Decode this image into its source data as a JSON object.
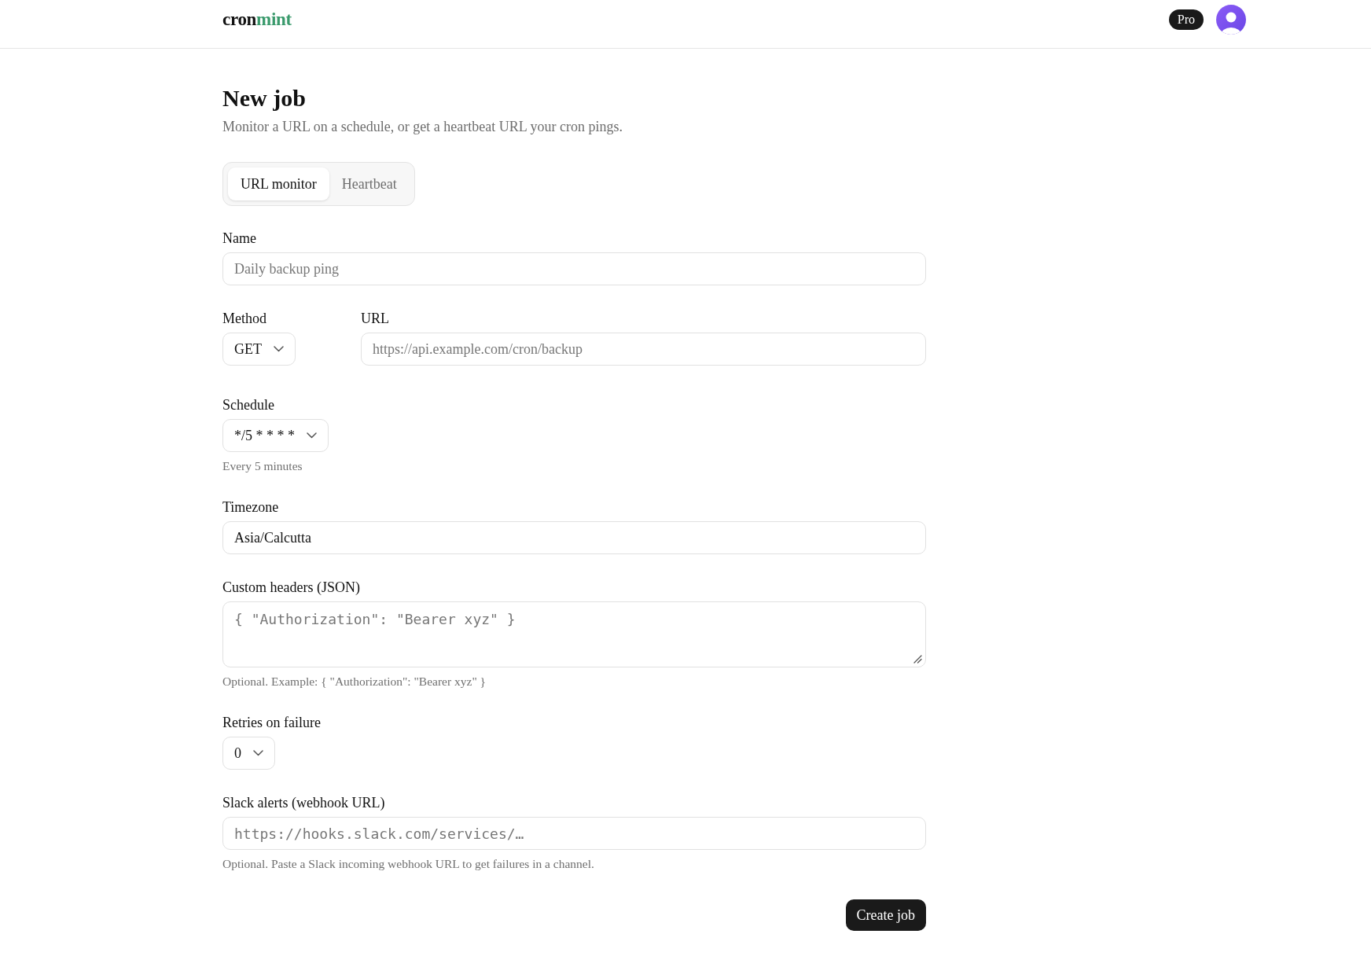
{
  "header": {
    "logo": {
      "text": "cron",
      "accent": "mint"
    },
    "plan_badge": "Pro"
  },
  "page": {
    "title": "New job",
    "subtitle": "Monitor a URL on a schedule, or get a heartbeat URL your cron pings."
  },
  "tabs": [
    {
      "label": "URL monitor",
      "selected": true
    },
    {
      "label": "Heartbeat",
      "selected": false
    }
  ],
  "form": {
    "fields": [
      {
        "kind": "text",
        "label": "Name",
        "placeholder": "Daily backup ping"
      },
      {
        "kind": "group",
        "fields": [
          {
            "kind": "select",
            "label": "Method",
            "value": "GET"
          },
          {
            "kind": "text",
            "label": "URL",
            "placeholder": "https://api.example.com/cron/backup"
          }
        ]
      },
      {
        "kind": "select",
        "label": "Schedule",
        "value": "*/5 * * * *",
        "hint": "Every 5 minutes"
      },
      {
        "kind": "text",
        "label": "Timezone",
        "value": "Asia/Calcutta"
      },
      {
        "kind": "code_area",
        "label": "Custom headers (JSON)",
        "placeholder": "{ \"Authorization\": \"Bearer xyz\" }",
        "hint": "Optional. Example: { \"Authorization\": \"Bearer xyz\" }"
      },
      {
        "kind": "select",
        "label": "Retries on failure",
        "value": "0"
      },
      {
        "kind": "code",
        "label": "Slack alerts (webhook URL)",
        "placeholder": "https://hooks.slack.com/services/…",
        "hint": "Optional. Paste a Slack incoming webhook URL to get failures in a channel."
      }
    ],
    "submit": "Create job"
  }
}
